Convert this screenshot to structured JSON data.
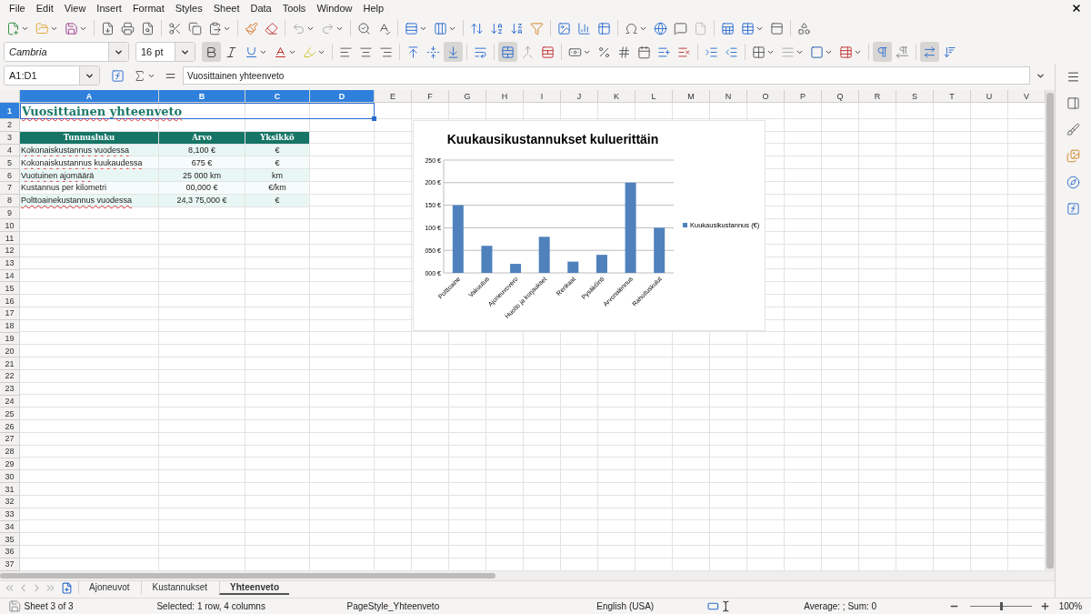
{
  "menu": [
    "File",
    "Edit",
    "View",
    "Insert",
    "Format",
    "Styles",
    "Sheet",
    "Data",
    "Tools",
    "Window",
    "Help"
  ],
  "format_toolbar": {
    "font_name": "Cambria",
    "font_size": "16 pt",
    "buttons": [
      {
        "kind": "bold",
        "on": true
      },
      {
        "kind": "italic",
        "on": false
      },
      {
        "kind": "underline",
        "on": false
      },
      {
        "kind": "font_color",
        "on": false
      },
      {
        "kind": "highlight",
        "on": false
      },
      {
        "kind": "align_left",
        "on": false
      },
      {
        "kind": "align_center",
        "on": false
      },
      {
        "kind": "align_right",
        "on": false
      },
      {
        "kind": "align_top",
        "on": false
      },
      {
        "kind": "align_middle",
        "on": false
      },
      {
        "kind": "align_bottom",
        "on": true
      },
      {
        "kind": "wrap",
        "on": false
      },
      {
        "kind": "merge_center",
        "on": true
      },
      {
        "kind": "merge",
        "on": false
      },
      {
        "kind": "unmerge",
        "on": false
      },
      {
        "kind": "currency",
        "on": false
      },
      {
        "kind": "percent",
        "on": false
      },
      {
        "kind": "number",
        "on": false
      },
      {
        "kind": "date",
        "on": false
      },
      {
        "kind": "add_decimal",
        "on": false
      },
      {
        "kind": "delete_decimal",
        "on": false
      },
      {
        "kind": "indent",
        "on": false
      },
      {
        "kind": "outdent",
        "on": false
      },
      {
        "kind": "borders",
        "on": false
      },
      {
        "kind": "border_style",
        "on": false
      },
      {
        "kind": "border_color",
        "on": false
      },
      {
        "kind": "conditional",
        "on": false
      },
      {
        "kind": "ltr",
        "on": true
      },
      {
        "kind": "rtl",
        "on": false
      },
      {
        "kind": "text_direction",
        "on": true
      },
      {
        "kind": "stacked",
        "on": false
      }
    ]
  },
  "formula_bar": {
    "name_box": "A1:D1",
    "value": "Vuosittainen yhteenveto"
  },
  "grid": {
    "columns": [
      {
        "label": "A",
        "selected": true
      },
      {
        "label": "B",
        "selected": true
      },
      {
        "label": "C",
        "selected": true
      },
      {
        "label": "D",
        "selected": true
      },
      {
        "label": "E",
        "selected": false
      },
      {
        "label": "F",
        "selected": false
      },
      {
        "label": "G",
        "selected": false
      },
      {
        "label": "H",
        "selected": false
      },
      {
        "label": "I",
        "selected": false
      },
      {
        "label": "J",
        "selected": false
      },
      {
        "label": "K",
        "selected": false
      },
      {
        "label": "L",
        "selected": false
      },
      {
        "label": "M",
        "selected": false
      },
      {
        "label": "N",
        "selected": false
      },
      {
        "label": "O",
        "selected": false
      },
      {
        "label": "P",
        "selected": false
      },
      {
        "label": "Q",
        "selected": false
      },
      {
        "label": "R",
        "selected": false
      },
      {
        "label": "S",
        "selected": false
      },
      {
        "label": "T",
        "selected": false
      },
      {
        "label": "U",
        "selected": false
      },
      {
        "label": "V",
        "selected": false
      }
    ],
    "rows": [
      {
        "number": "1",
        "selected": true,
        "kind": "title",
        "text": "Vuosittainen yhteenveto",
        "spell_error": true
      },
      {
        "number": "2",
        "selected": false
      },
      {
        "number": "3",
        "selected": false,
        "kind": "header",
        "cells": [
          "Tunnusluku",
          "Arvo",
          "Yksikkö"
        ]
      },
      {
        "number": "4",
        "selected": false,
        "kind": "data",
        "shaded": true,
        "spell_error": true,
        "cells": [
          "Kokonaiskustannus vuodessa",
          "8,100 €",
          "€"
        ]
      },
      {
        "number": "5",
        "selected": false,
        "kind": "data",
        "shaded": false,
        "spell_error": true,
        "cells": [
          "Kokonaiskustannus kuukaudessa",
          "675 €",
          "€"
        ]
      },
      {
        "number": "6",
        "selected": false,
        "kind": "data",
        "shaded": true,
        "spell_error": true,
        "cells": [
          "Vuotuinen ajomäärä",
          "25 000 km",
          "km"
        ]
      },
      {
        "number": "7",
        "selected": false,
        "kind": "data",
        "shaded": false,
        "spell_error": false,
        "cells": [
          "Kustannus per kilometri",
          "00,000 €",
          "€/km"
        ]
      },
      {
        "number": "8",
        "selected": false,
        "kind": "data",
        "shaded": true,
        "spell_error": true,
        "cells": [
          "Polttoainekustannus vuodessa",
          "24,3 75,000 €",
          "€"
        ]
      },
      {
        "number": "9",
        "selected": false
      },
      {
        "number": "10",
        "selected": false
      },
      {
        "number": "11",
        "selected": false
      },
      {
        "number": "12",
        "selected": false
      },
      {
        "number": "13",
        "selected": false
      },
      {
        "number": "14",
        "selected": false
      },
      {
        "number": "15",
        "selected": false
      },
      {
        "number": "16",
        "selected": false
      },
      {
        "number": "17",
        "selected": false
      },
      {
        "number": "18",
        "selected": false
      },
      {
        "number": "19",
        "selected": false
      },
      {
        "number": "20",
        "selected": false
      },
      {
        "number": "21",
        "selected": false
      },
      {
        "number": "22",
        "selected": false
      },
      {
        "number": "23",
        "selected": false
      },
      {
        "number": "24",
        "selected": false
      },
      {
        "number": "25",
        "selected": false
      },
      {
        "number": "26",
        "selected": false
      },
      {
        "number": "27",
        "selected": false
      },
      {
        "number": "28",
        "selected": false
      },
      {
        "number": "29",
        "selected": false
      },
      {
        "number": "30",
        "selected": false
      },
      {
        "number": "31",
        "selected": false
      },
      {
        "number": "32",
        "selected": false
      },
      {
        "number": "33",
        "selected": false
      },
      {
        "number": "34",
        "selected": false
      },
      {
        "number": "35",
        "selected": false
      },
      {
        "number": "36",
        "selected": false
      },
      {
        "number": "37",
        "selected": false
      }
    ],
    "chart": {
      "chart_data": {
        "type": "bar",
        "title": "Kuukausikustannukset kuluerittäin",
        "categories": [
          "Polttoaine",
          "Vakuutus",
          "Ajoneuvovero",
          "Huolto ja korjaukset",
          "Renkaat",
          "Pysäköinti",
          "Arvonalennus",
          "Rahoituskulut"
        ],
        "series": [
          {
            "name": "Kuukausikustannus (€)",
            "color": "#4f81bd",
            "values": [
              150,
              60,
              20,
              80,
              25,
              40,
              200,
              100
            ]
          }
        ],
        "grid": true,
        "ylim": [
          0,
          250
        ],
        "yticks": [
          {
            "value": 0,
            "label": "000 €"
          },
          {
            "value": 50,
            "label": "050 €"
          },
          {
            "value": 100,
            "label": "100 €"
          },
          {
            "value": 150,
            "label": "150 €"
          },
          {
            "value": 200,
            "label": "200 €"
          },
          {
            "value": 250,
            "label": "250 €"
          }
        ]
      }
    }
  },
  "sheet_tabs": [
    {
      "label": "Ajoneuvot",
      "selected": false
    },
    {
      "label": "Kustannukset",
      "selected": false
    },
    {
      "label": "Yhteenveto",
      "selected": true
    }
  ],
  "status_bar": {
    "sheet": "Sheet 3 of 3",
    "selection": "Selected: 1 row, 4 columns",
    "page_style": "PageStyle_Yhteenveto",
    "language": "English (USA)",
    "summary": "Average: ; Sum: 0",
    "zoom": {
      "level": 0.5,
      "reading": "100%"
    }
  }
}
